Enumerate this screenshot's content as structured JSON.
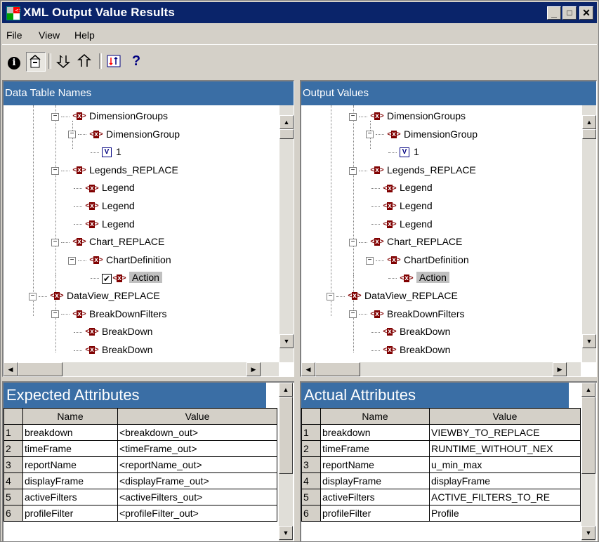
{
  "window": {
    "title": "XML Output Value Results",
    "minimize_glyph": "_",
    "maximize_glyph": "□",
    "close_glyph": "✕"
  },
  "menu": [
    "File",
    "View",
    "Help"
  ],
  "toolbar": {
    "icons": [
      "info-icon",
      "properties-icon",
      "expand-all-icon",
      "collapse-all-icon",
      "sort-icon",
      "help-icon"
    ],
    "info_glyph": "i",
    "help_glyph": "?"
  },
  "left_pane": {
    "title": "Data Table Names",
    "tree": [
      {
        "label": "DimensionGroups",
        "icon": "element"
      },
      {
        "label": "DimensionGroup",
        "icon": "element"
      },
      {
        "label": "1",
        "icon": "value"
      },
      {
        "label": "Legends_REPLACE",
        "icon": "element"
      },
      {
        "label": "Legend",
        "icon": "element"
      },
      {
        "label": "Legend",
        "icon": "element"
      },
      {
        "label": "Legend",
        "icon": "element"
      },
      {
        "label": "Chart_REPLACE",
        "icon": "element"
      },
      {
        "label": "ChartDefinition",
        "icon": "element"
      },
      {
        "label": "Action",
        "icon": "element",
        "checked": true,
        "selected": true
      },
      {
        "label": "DataView_REPLACE",
        "icon": "element"
      },
      {
        "label": "BreakDownFilters",
        "icon": "element"
      },
      {
        "label": "BreakDown",
        "icon": "element"
      },
      {
        "label": "BreakDown",
        "icon": "element"
      }
    ]
  },
  "right_pane": {
    "title": "Output Values",
    "tree": [
      {
        "label": "DimensionGroups",
        "icon": "element"
      },
      {
        "label": "DimensionGroup",
        "icon": "element"
      },
      {
        "label": "1",
        "icon": "value"
      },
      {
        "label": "Legends_REPLACE",
        "icon": "element"
      },
      {
        "label": "Legend",
        "icon": "element"
      },
      {
        "label": "Legend",
        "icon": "element"
      },
      {
        "label": "Legend",
        "icon": "element"
      },
      {
        "label": "Chart_REPLACE",
        "icon": "element"
      },
      {
        "label": "ChartDefinition",
        "icon": "element"
      },
      {
        "label": "Action",
        "icon": "element",
        "selected": true
      },
      {
        "label": "DataView_REPLACE",
        "icon": "element"
      },
      {
        "label": "BreakDownFilters",
        "icon": "element"
      },
      {
        "label": "BreakDown",
        "icon": "element"
      },
      {
        "label": "BreakDown",
        "icon": "element"
      }
    ]
  },
  "expected": {
    "title": "Expected Attributes",
    "columns": [
      "Name",
      "Value"
    ],
    "rows": [
      [
        "1",
        "breakdown",
        "<breakdown_out>"
      ],
      [
        "2",
        "timeFrame",
        "<timeFrame_out>"
      ],
      [
        "3",
        "reportName",
        "<reportName_out>"
      ],
      [
        "4",
        "displayFrame",
        "<displayFrame_out>"
      ],
      [
        "5",
        "activeFilters",
        "<activeFilters_out>"
      ],
      [
        "6",
        "profileFilter",
        "<profileFilter_out>"
      ]
    ]
  },
  "actual": {
    "title": "Actual Attributes",
    "columns": [
      "Name",
      "Value"
    ],
    "rows": [
      [
        "1",
        "breakdown",
        "VIEWBY_TO_REPLACE"
      ],
      [
        "2",
        "timeFrame",
        "RUNTIME_WITHOUT_NEX"
      ],
      [
        "3",
        "reportName",
        "u_min_max"
      ],
      [
        "4",
        "displayFrame",
        "displayFrame"
      ],
      [
        "5",
        "activeFilters",
        "ACTIVE_FILTERS_TO_RE"
      ],
      [
        "6",
        "profileFilter",
        "Profile"
      ]
    ]
  },
  "colors": {
    "titlebar": "#0a246a",
    "header": "#3a6ea5",
    "face": "#d4d0c8"
  }
}
